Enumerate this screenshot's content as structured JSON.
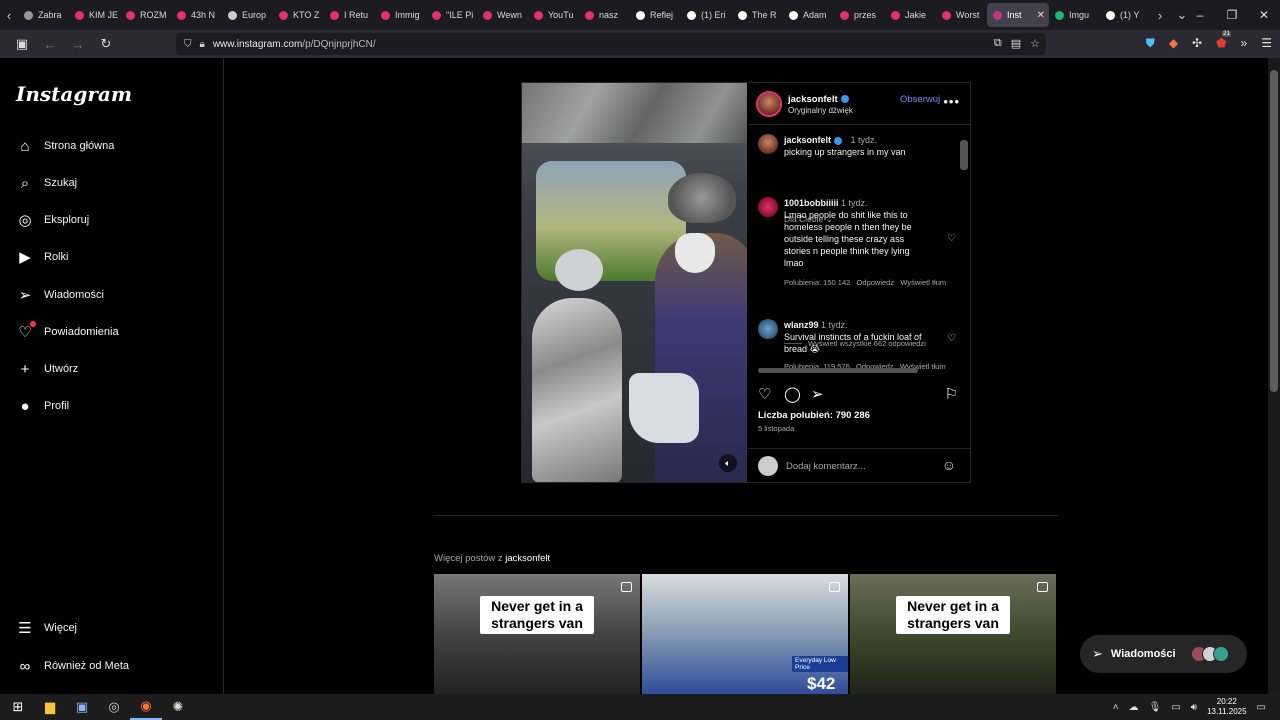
{
  "browser": {
    "tabs": [
      {
        "label": "Zabra",
        "color": "#999999"
      },
      {
        "label": "KIM JE",
        "color": "#e1306c"
      },
      {
        "label": "ROZM",
        "color": "#e1306c"
      },
      {
        "label": "43h N",
        "color": "#e1306c"
      },
      {
        "label": "Europ",
        "color": "#cccccc"
      },
      {
        "label": "KTO Z",
        "color": "#e1306c"
      },
      {
        "label": "I Retu",
        "color": "#e1306c"
      },
      {
        "label": "Immig",
        "color": "#e1306c"
      },
      {
        "label": "\"ILE Pi",
        "color": "#e1306c"
      },
      {
        "label": "Wewn",
        "color": "#e1306c"
      },
      {
        "label": "YouTu",
        "color": "#e1306c"
      },
      {
        "label": "nasz",
        "color": "#e1306c"
      },
      {
        "label": "Reflej",
        "color": "#ffffff"
      },
      {
        "label": "(1) Eri",
        "color": "#ffffff"
      },
      {
        "label": "The R",
        "color": "#ffffff"
      },
      {
        "label": "Adam",
        "color": "#ffffff"
      },
      {
        "label": "przes",
        "color": "#e1306c"
      },
      {
        "label": "Jakie",
        "color": "#e1306c"
      },
      {
        "label": "Worst",
        "color": "#e1306c"
      },
      {
        "label": "Inst",
        "color": "#c13584",
        "active": true
      },
      {
        "label": "Imgu",
        "color": "#1bb76e"
      },
      {
        "label": "(1) Y",
        "color": "#ffffff"
      }
    ],
    "url_host": "www.instagram.com",
    "url_path": "/p/DQnjnprjhCN/",
    "extension_badge": "21"
  },
  "sidebar": {
    "logo": "Instagram",
    "items": [
      {
        "label": "Strona główna",
        "icon": "home-icon"
      },
      {
        "label": "Szukaj",
        "icon": "search-icon"
      },
      {
        "label": "Eksploruj",
        "icon": "compass-icon"
      },
      {
        "label": "Rolki",
        "icon": "reels-icon"
      },
      {
        "label": "Wiadomości",
        "icon": "send-icon"
      },
      {
        "label": "Powiadomienia",
        "icon": "heart-icon"
      },
      {
        "label": "Utwórz",
        "icon": "plus-icon"
      },
      {
        "label": "Profil",
        "icon": "profile-icon"
      }
    ],
    "bottom_items": [
      {
        "label": "Więcej",
        "icon": "menu-icon"
      },
      {
        "label": "Również od Meta",
        "icon": "meta-icon"
      }
    ]
  },
  "post": {
    "username": "jacksonfelt",
    "audio": "Oryginalny dźwięk",
    "follow_label": "Obserwuj",
    "caption": {
      "username": "jacksonfelt",
      "time": "1 tydz.",
      "text": "picking up strangers in my van"
    },
    "filter_label": "Dla Ciebie",
    "comments": [
      {
        "username": "1001bobbiiiii",
        "time": "1 tydz.",
        "text": "Lmao people do shit like this to homeless people n then they be outside telling these crazy ass stories n people think they lying lmao",
        "likes": "Polubienia: 150 142",
        "reply": "Odpowiedz",
        "translate": "Wyświetl tłum"
      },
      {
        "username": "wlanz99",
        "time": "1 tydz.",
        "text": "Survival instincts of a fuckin loaf of bread 😭",
        "likes": "Polubienia: 119 576",
        "reply": "Odpowiedz",
        "translate": "Wyświetl tłum"
      }
    ],
    "view_replies": "Wyświetl wszystkie 662 odpowiedzi",
    "likes_count": "Liczba polubień: 790 286",
    "date": "5 listopada",
    "comment_placeholder": "Dodaj komentarz..."
  },
  "more_posts": {
    "prefix": "Więcej postów z",
    "username": "jacksonfelt",
    "items": [
      {
        "caption": "Never get in a strangers van"
      },
      {
        "caption": "",
        "price_tag": "Everyday Low Price",
        "price": "$42"
      },
      {
        "caption": "Never get in a strangers van"
      }
    ]
  },
  "messages_pill": {
    "label": "Wiadomości"
  },
  "taskbar": {
    "time": "20:22",
    "date": "13.11.2025"
  }
}
